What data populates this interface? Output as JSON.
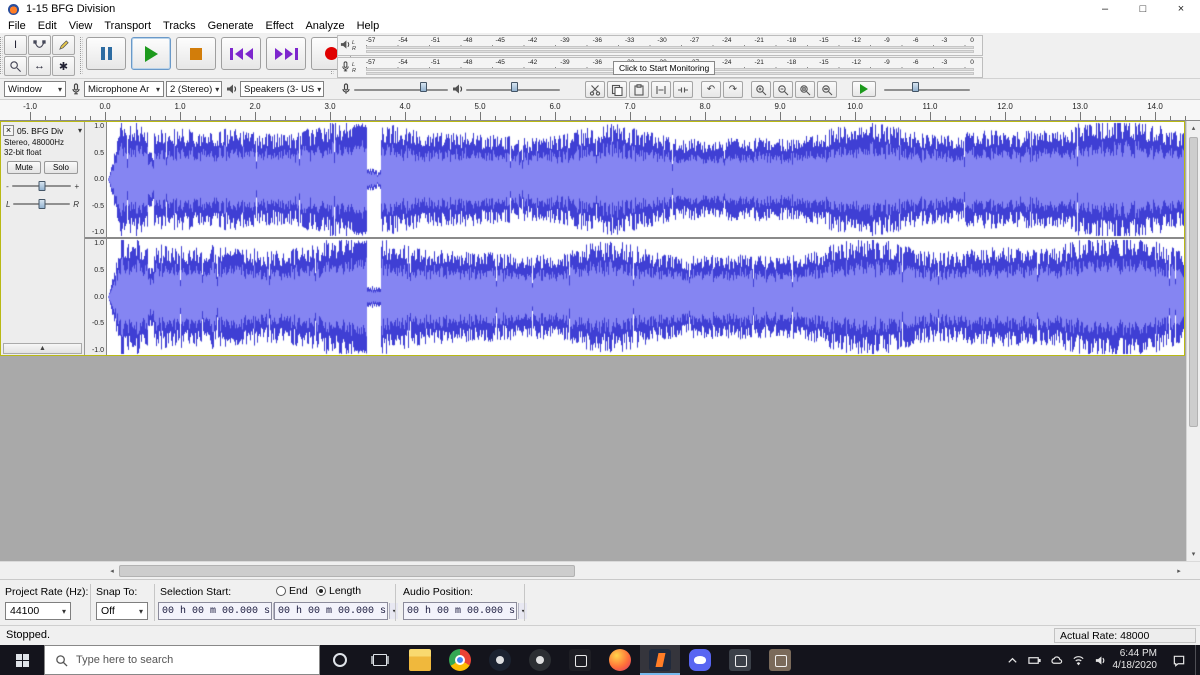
{
  "titlebar": {
    "title": "1-15 BFG Division"
  },
  "menubar": {
    "items": [
      "File",
      "Edit",
      "View",
      "Transport",
      "Tracks",
      "Generate",
      "Effect",
      "Analyze",
      "Help"
    ]
  },
  "meter": {
    "scale": [
      -57,
      -54,
      -51,
      -48,
      -45,
      -42,
      -39,
      -36,
      -33,
      -30,
      -27,
      -24,
      -21,
      -18,
      -15,
      -12,
      -9,
      -6,
      -3,
      0
    ],
    "monitor_label": "Click to Start Monitoring"
  },
  "device": {
    "host": "Window",
    "mic": "Microphone Ar",
    "channels": "2 (Stereo)",
    "out": "Speakers (3- US"
  },
  "timeline": {
    "ticks": [
      "-1.0",
      "0.0",
      "1.0",
      "2.0",
      "3.0",
      "4.0",
      "5.0",
      "6.0",
      "7.0",
      "8.0",
      "9.0",
      "10.0",
      "11.0",
      "12.0",
      "13.0",
      "14.0"
    ]
  },
  "track": {
    "name": "05. BFG Div",
    "format1": "Stereo, 48000Hz",
    "format2": "32-bit float",
    "mute": "Mute",
    "solo": "Solo",
    "gain_minus": "-",
    "gain_plus": "+",
    "pan_left": "L",
    "pan_right": "R",
    "scale": [
      "1.0",
      "0.5",
      "0.0",
      "-0.5",
      "-1.0"
    ]
  },
  "selection": {
    "rate_label": "Project Rate (Hz):",
    "rate_value": "44100",
    "snap_label": "Snap To:",
    "snap_value": "Off",
    "sel_start_label": "Selection Start:",
    "end_label": "End",
    "length_label": "Length",
    "audio_pos_label": "Audio Position:",
    "time_start": "00 h 00 m 00.000 s",
    "time_length": "00 h 00 m 00.000 s",
    "time_audio": "00 h 00 m 00.000 s"
  },
  "statusbar": {
    "status": "Stopped.",
    "rate": "Actual Rate: 48000"
  },
  "taskbar": {
    "search_placeholder": "Type here to search",
    "time": "6:44 PM",
    "date": "4/18/2020",
    "apps": [
      {
        "name": "file-explorer",
        "color": "#f6c84c",
        "style": "folder"
      },
      {
        "name": "chrome",
        "color": "#4285f4",
        "style": "chrome"
      },
      {
        "name": "steam",
        "color": "#1b2230",
        "style": "round"
      },
      {
        "name": "discord",
        "color": "#2c2f33",
        "style": "round"
      },
      {
        "name": "media-app",
        "color": "#1e1e24",
        "style": "square"
      },
      {
        "name": "firefox",
        "color": "#ff7139",
        "style": "firefox"
      },
      {
        "name": "audacity",
        "color": "#202a3c",
        "style": "audacity",
        "active": true
      },
      {
        "name": "discord-blue",
        "color": "#5865f2",
        "style": "rounded"
      },
      {
        "name": "calculator",
        "color": "#3b4048",
        "style": "square"
      },
      {
        "name": "gimp",
        "color": "#7a6a5a",
        "style": "square"
      }
    ]
  },
  "icons": {
    "close": "×",
    "dropdown": "▾",
    "collapse": "▲",
    "undo": "↶",
    "redo": "↷",
    "min": "–",
    "max": "□",
    "x": "×",
    "timeshift": "↔",
    "multitool": "✱",
    "ibeam": "I",
    "left": "◂",
    "right": "▸",
    "up": "▴",
    "down": "▾"
  },
  "colors": {
    "waveform_peak": "#3f3fd4",
    "waveform_rms": "#8585f2",
    "accent_play": "#1d9a1d",
    "accent_record": "#e00000",
    "accent_stop": "#d27d0a",
    "accent_pause": "#2d6ca2",
    "accent_skip": "#7d26cd",
    "taskbar_bg": "#14141c",
    "active_underline": "#76b9ed",
    "focus_border": "#b9b914"
  }
}
